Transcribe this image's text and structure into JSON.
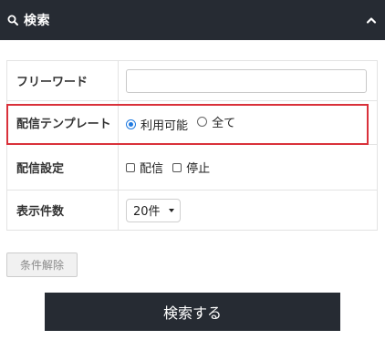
{
  "header": {
    "title": "検索",
    "search_icon": "search-icon",
    "collapse_icon": "chevron-up-icon"
  },
  "form": {
    "freeword": {
      "label": "フリーワード",
      "value": "",
      "placeholder": ""
    },
    "template": {
      "label": "配信テンプレート",
      "options": [
        {
          "label": "利用可能",
          "checked": true
        },
        {
          "label": "全て",
          "checked": false
        }
      ]
    },
    "setting": {
      "label": "配信設定",
      "options": [
        {
          "label": "配信",
          "checked": false
        },
        {
          "label": "停止",
          "checked": false
        }
      ]
    },
    "count": {
      "label": "表示件数",
      "selected": "20件"
    }
  },
  "buttons": {
    "clear": "条件解除",
    "search": "検索する"
  },
  "colors": {
    "header_bg": "#262b33",
    "highlight": "#d9313a",
    "radio_accent": "#1f7ae0"
  }
}
